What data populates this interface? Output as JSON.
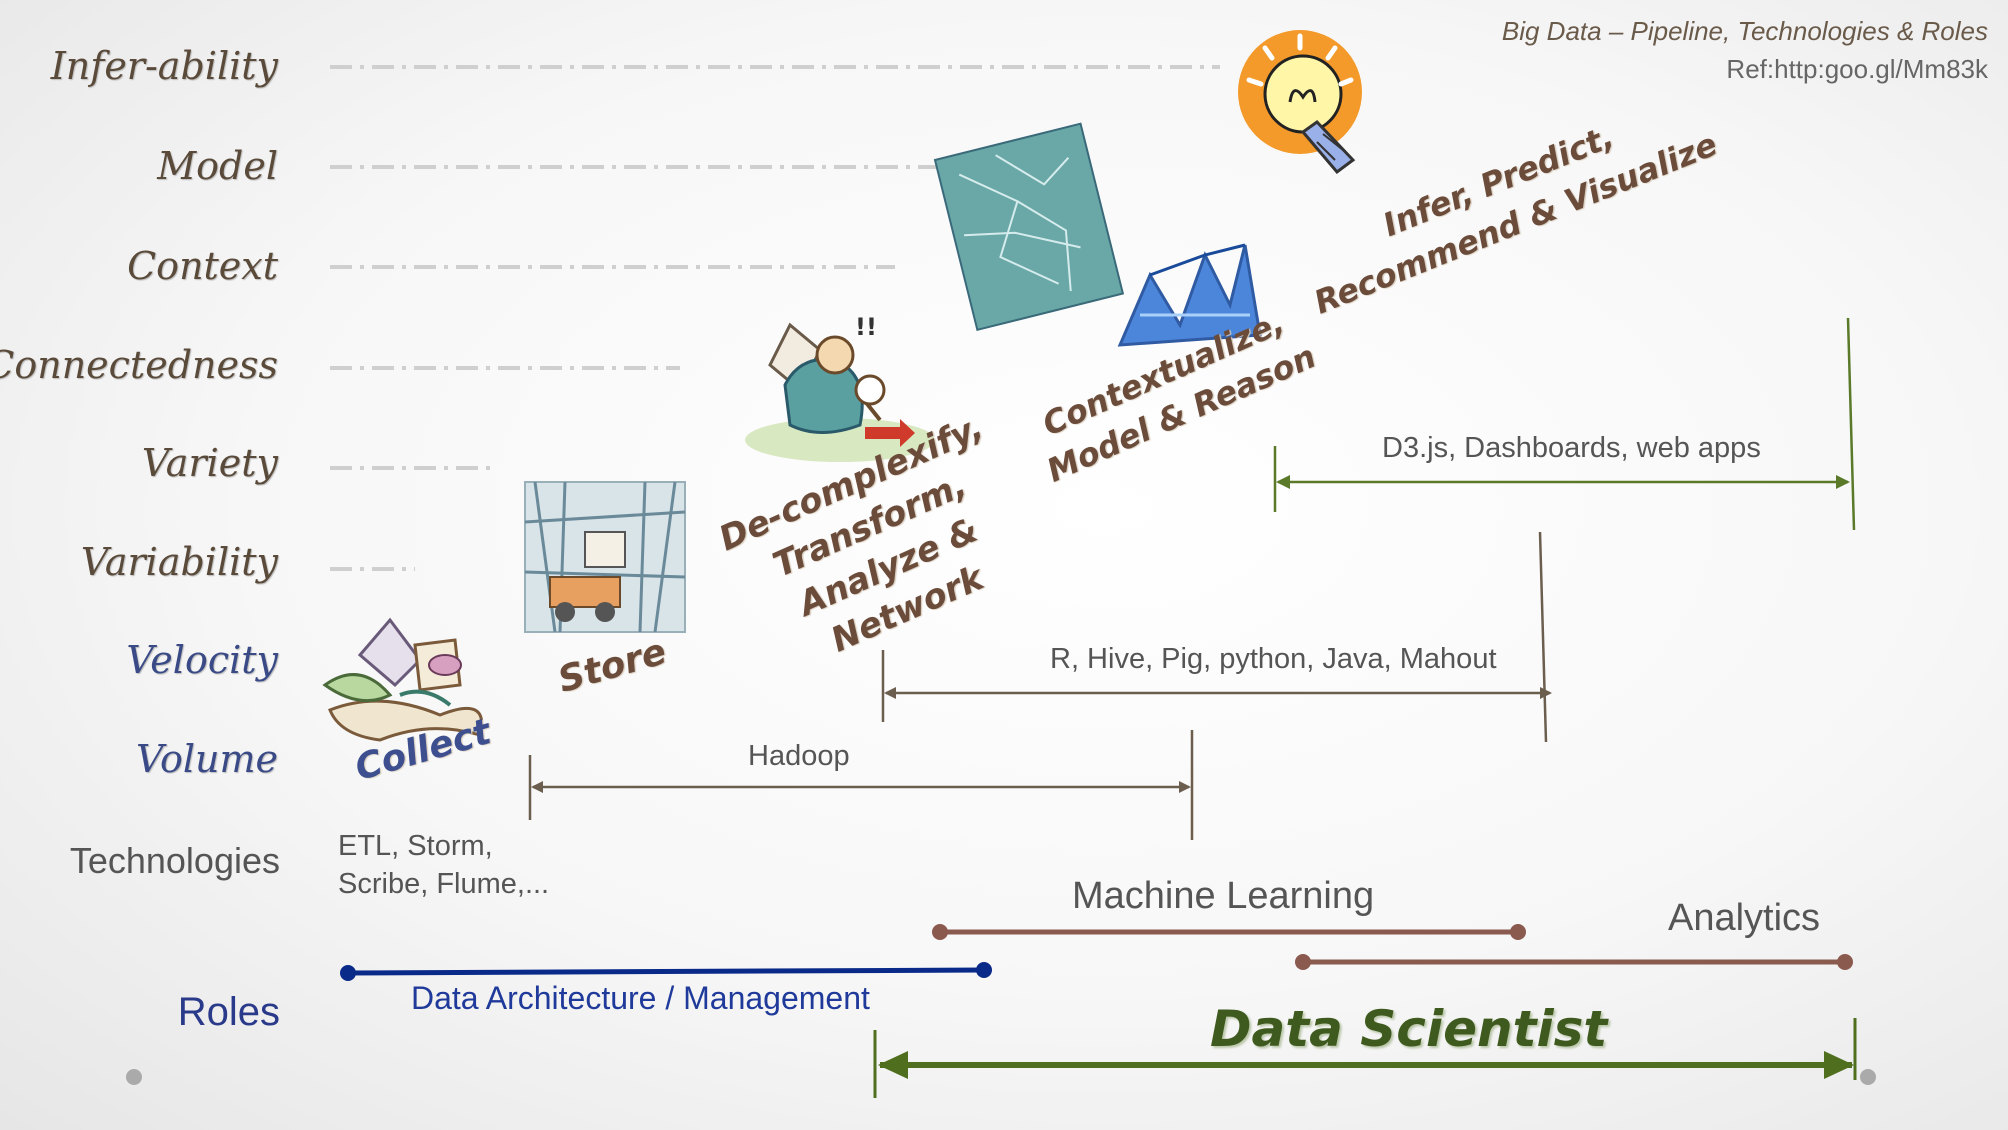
{
  "header": {
    "title": "Big Data – Pipeline, Technologies & Roles",
    "ref": "Ref:http:goo.gl/Mm83k"
  },
  "row_labels": {
    "infer_ability": "Infer-ability",
    "model": "Model",
    "context": "Context",
    "connectedness": "Connectedness",
    "variety": "Variety",
    "variability": "Variability",
    "velocity": "Velocity",
    "volume": "Volume",
    "technologies": "Technologies",
    "roles": "Roles"
  },
  "stages": {
    "collect": "Collect",
    "store": "Store",
    "decomplexify": [
      "De-complexify,",
      "Transform,",
      "Analyze &",
      "Network"
    ],
    "contextualize": [
      "Contextualize,",
      "Model & Reason"
    ],
    "infer": [
      "Infer, Predict,",
      "Recommend & Visualize"
    ]
  },
  "technologies": {
    "etl_line1": "ETL, Storm,",
    "etl_line2": "Scribe, Flume,...",
    "hadoop": "Hadoop",
    "r_hive": "R, Hive, Pig, python, Java, Mahout",
    "d3": "D3.js, Dashboards, web apps"
  },
  "roles": {
    "data_architecture": "Data Architecture / Management",
    "machine_learning": "Machine Learning",
    "analytics": "Analytics",
    "data_scientist": "Data Scientist"
  },
  "colors": {
    "label_brown": "#5a4a3a",
    "label_blue": "#3a4a86",
    "bracket": "#6b5e4e",
    "d3_green": "#5a7a2a",
    "arch_blue": "#0a2a8a",
    "ml_brown": "#8a5a4e",
    "scientist_green": "#4f6e1e"
  }
}
